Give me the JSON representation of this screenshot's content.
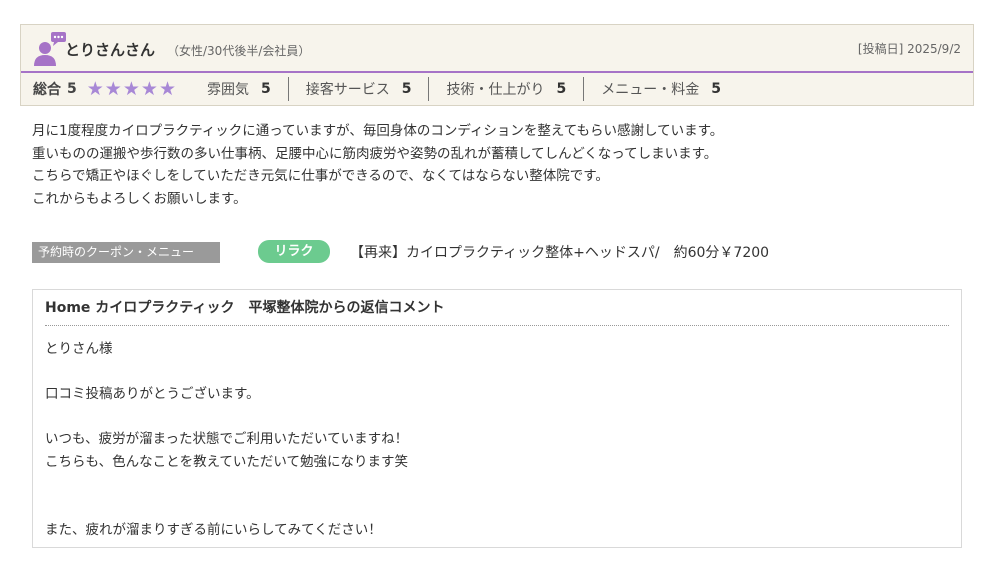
{
  "reviewer": {
    "name": "とりさんさん",
    "attributes": "（女性/30代後半/会社員）",
    "post_date": "[投稿日] 2025/9/2",
    "avatar_icon": "user-comment-icon",
    "avatar_color": "#a673c7"
  },
  "ratings": {
    "overall_label": "総合",
    "overall_score": "5",
    "stars": 5,
    "star_icon": "star-icon",
    "star_color": "#a888d6",
    "categories": [
      {
        "label": "雰囲気",
        "score": "5"
      },
      {
        "label": "接客サービス",
        "score": "5"
      },
      {
        "label": "技術・仕上がり",
        "score": "5"
      },
      {
        "label": "メニュー・料金",
        "score": "5"
      }
    ]
  },
  "review": {
    "lines": [
      "月に1度程度カイロプラクティックに通っていますが、毎回身体のコンディションを整えてもらい感謝しています。",
      "重いものの運搬や歩行数の多い仕事柄、足腰中心に筋肉疲労や姿勢の乱れが蓄積してしんどくなってしまいます。",
      "こちらで矯正やほぐしをしていただき元気に仕事ができるので、なくてはならない整体院です。",
      "これからもよろしくお願いします。"
    ]
  },
  "coupon": {
    "label": "予約時のクーポン・メニュー",
    "tag": "リラク",
    "tag_color": "#6ccb8f",
    "name": "【再来】カイロプラクティック整体+ヘッドスパ/　約60分￥7200"
  },
  "reply": {
    "title": "Home カイロプラクティック　平塚整体院からの返信コメント",
    "lines": [
      "とりさん様",
      "口コミ投稿ありがとうございます。",
      "いつも、疲労が溜まった状態でご利用いただいていますね！",
      "こちらも、色んなことを教えていただいて勉強になります笑",
      "また、疲れが溜まりすぎる前にいらしてみてください！"
    ]
  },
  "colors": {
    "header_bg": "#f7f4ec",
    "accent_line": "#a673c7",
    "coupon_label_bg": "#9a9a9a"
  }
}
